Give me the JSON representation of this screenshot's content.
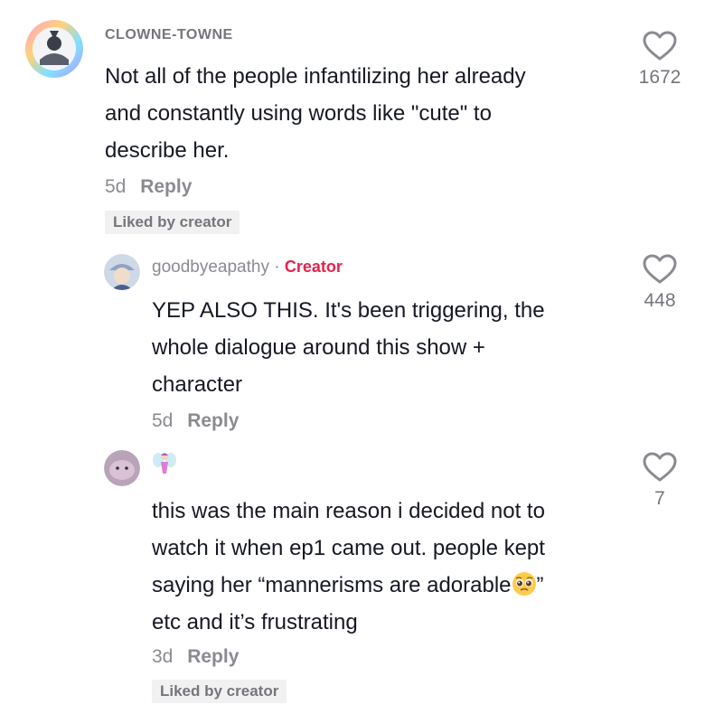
{
  "comments": [
    {
      "username": "CLOWNE-TOWNE",
      "text_lines": [
        "Not all of the people infantilizing her already",
        "and constantly using words like \"cute\" to",
        "describe her."
      ],
      "time": "5d",
      "reply_label": "Reply",
      "liked_label": "Liked by creator",
      "like_count": "1672"
    },
    {
      "username": "goodbyeapathy",
      "separator": "·",
      "creator_label": "Creator",
      "text_lines": [
        "YEP ALSO THIS. It's been triggering, the",
        "whole dialogue around this show +",
        "character"
      ],
      "time": "5d",
      "reply_label": "Reply",
      "like_count": "448"
    },
    {
      "username_icon": "fairy-emoji-icon",
      "text_lines": [
        "this was the main reason i decided not to",
        "watch it when ep1 came out. people kept",
        "saying her “mannerisms are adorable",
        "etc and it’s frustrating"
      ],
      "text_line3_suffix": "”",
      "inline_emoji": "pleading-face-emoji-icon",
      "time": "3d",
      "reply_label": "Reply",
      "liked_label": "Liked by creator",
      "like_count": "7"
    }
  ],
  "colors": {
    "creator": "#e1244f",
    "muted": "#8a8b91",
    "text": "#161823"
  }
}
